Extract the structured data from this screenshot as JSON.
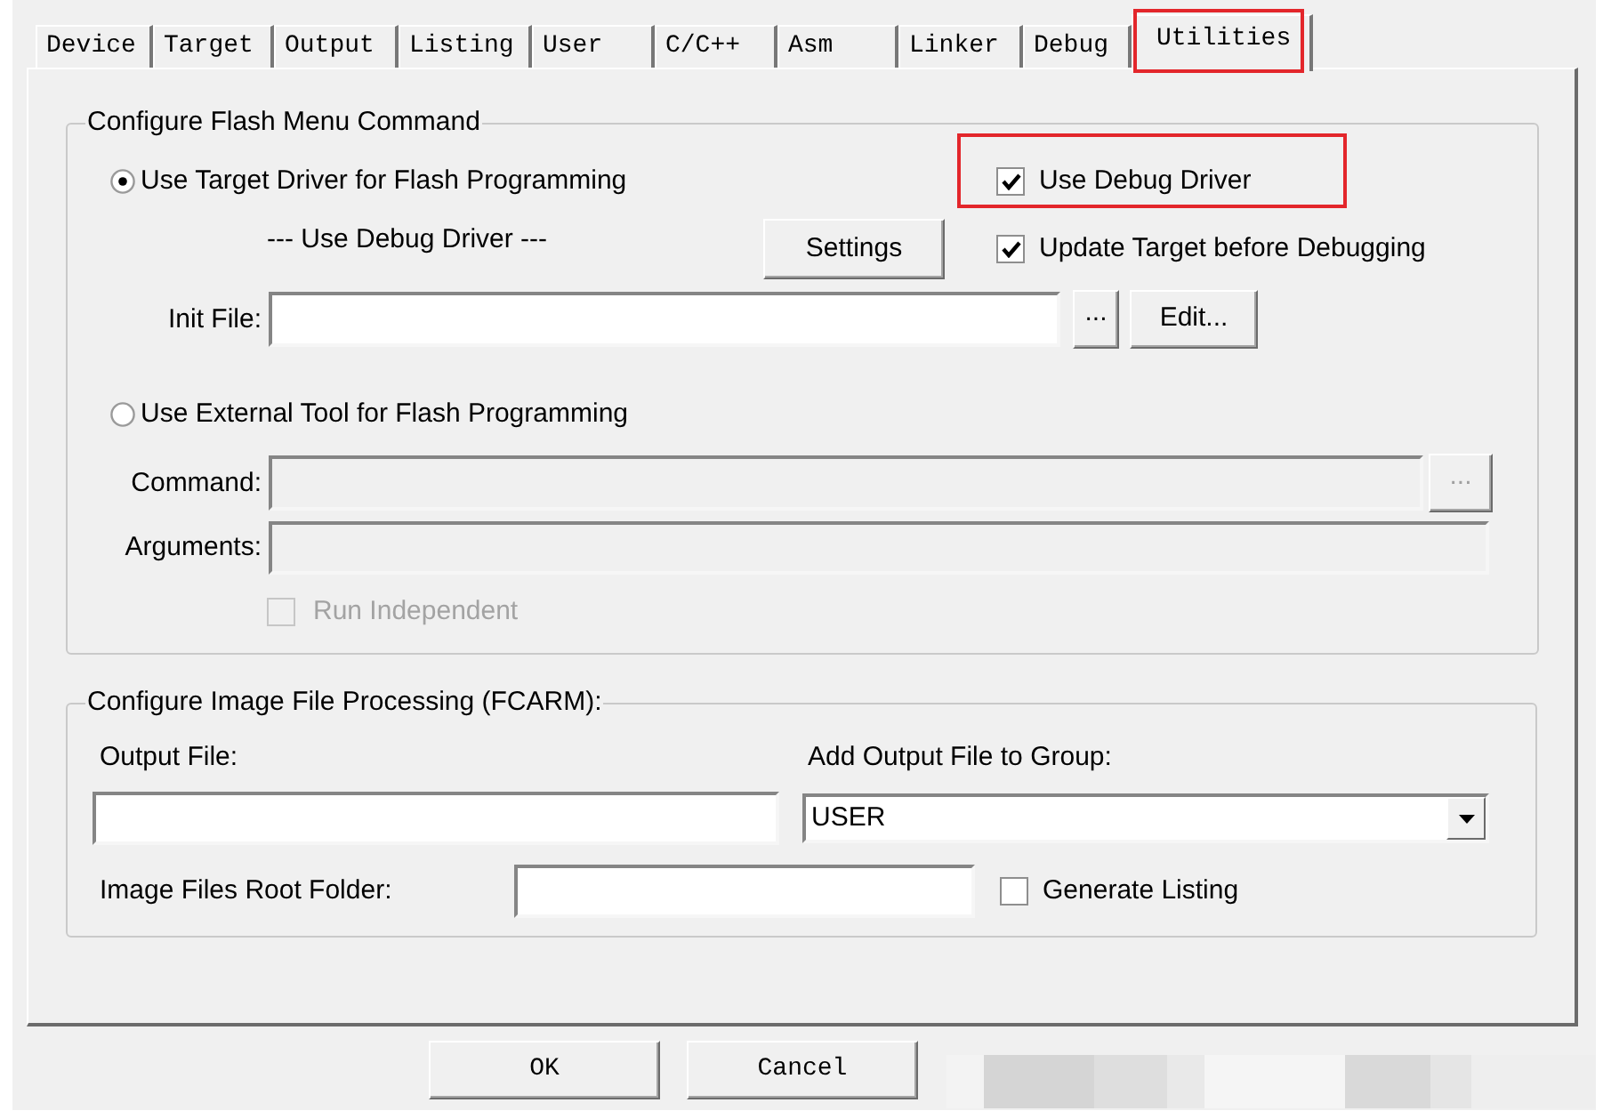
{
  "tabs": [
    {
      "label": "Device",
      "selected": false,
      "highlighted": false
    },
    {
      "label": "Target",
      "selected": false,
      "highlighted": false
    },
    {
      "label": "Output",
      "selected": false,
      "highlighted": false
    },
    {
      "label": "Listing",
      "selected": false,
      "highlighted": false
    },
    {
      "label": "User",
      "selected": false,
      "highlighted": false
    },
    {
      "label": "C/C++",
      "selected": false,
      "highlighted": false
    },
    {
      "label": "Asm",
      "selected": false,
      "highlighted": false
    },
    {
      "label": "Linker",
      "selected": false,
      "highlighted": false
    },
    {
      "label": "Debug",
      "selected": false,
      "highlighted": false
    },
    {
      "label": "Utilities",
      "selected": true,
      "highlighted": true
    }
  ],
  "flash_group": {
    "title": "Configure Flash Menu Command",
    "options": [
      {
        "label": "Use Target Driver for Flash Programming",
        "selected": true
      },
      {
        "label": "Use External Tool for Flash Programming",
        "selected": false
      }
    ],
    "use_debug_driver": {
      "label": "Use Debug Driver",
      "checked": true,
      "highlighted": true
    },
    "driver_label": "--- Use Debug Driver ---",
    "settings_button": "Settings",
    "update_target": {
      "label": "Update Target before Debugging",
      "checked": true
    },
    "init_file": {
      "label": "Init File:",
      "browse_button": "...",
      "edit_button": "Edit..."
    },
    "command": {
      "label": "Command:",
      "disabled": true,
      "browse_button": "..."
    },
    "arguments": {
      "label": "Arguments:",
      "disabled": true
    },
    "run_independent": {
      "label": "Run Independent",
      "checked": false,
      "disabled": true
    }
  },
  "image_group": {
    "title": "Configure Image File Processing (FCARM):",
    "output_file": {
      "label": "Output File:"
    },
    "group": {
      "label": "Add Output File to Group:",
      "value": "USER"
    },
    "root_folder": {
      "label": "Image Files Root Folder:"
    },
    "generate_listing": {
      "label": "Generate Listing",
      "checked": false
    }
  },
  "buttons": [
    {
      "label": "OK"
    },
    {
      "label": "Cancel"
    }
  ]
}
